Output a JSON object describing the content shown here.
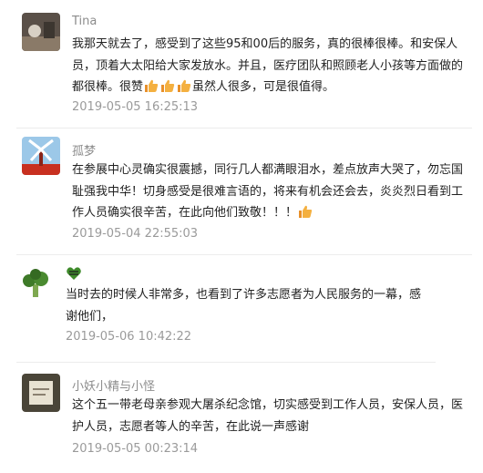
{
  "comments": [
    {
      "user": "Tina",
      "avatar_icon": "avatar-photo-icon",
      "text_parts": [
        "我那天就去了，感受到了这些95和00后的服务，真的很棒很棒。和安保人员，顶着大太阳给大家发放水。并且，医疗团队和照顾老人小孩等方面做的都很棒。很赞",
        "虽然人很多，可是很值得。"
      ],
      "emoji": "thumbs-up-icon",
      "timestamp": "2019-05-05 16:25:13"
    },
    {
      "user": "孤梦",
      "avatar_icon": "windmill-avatar-icon",
      "text": "在参展中心灵确实很震撼，同行几人都满眼泪水，差点放声大哭了，勿忘国耻强我中华！切身感受是很难言语的，将来有机会还会去，炎炎烈日看到工作人员确实很辛苦，在此向他们致敬！！！",
      "emoji": "thumbs-up-icon",
      "timestamp": "2019-05-04 22:55:03"
    },
    {
      "user": "",
      "avatar_icon": "broccoli-avatar-icon",
      "name_icon": "heart-badge-icon",
      "text": "当时去的时候人非常多，也看到了许多志愿者为人民服务的一幕，感谢他们，",
      "timestamp": "2019-05-06 10:42:22"
    },
    {
      "user": "小妖小精与小怪",
      "avatar_icon": "photo-avatar-icon",
      "text": "这个五一带老母亲参观大屠杀纪念馆，切实感受到工作人员，安保人员，医护人员，志愿者等人的辛苦，在此说一声感谢",
      "timestamp": "2019-05-05 00:23:14"
    }
  ],
  "colors": {
    "name": "#8c8c8c",
    "timestamp": "#9a9a9a",
    "body": "#222222",
    "thumb": "#f0a030"
  }
}
